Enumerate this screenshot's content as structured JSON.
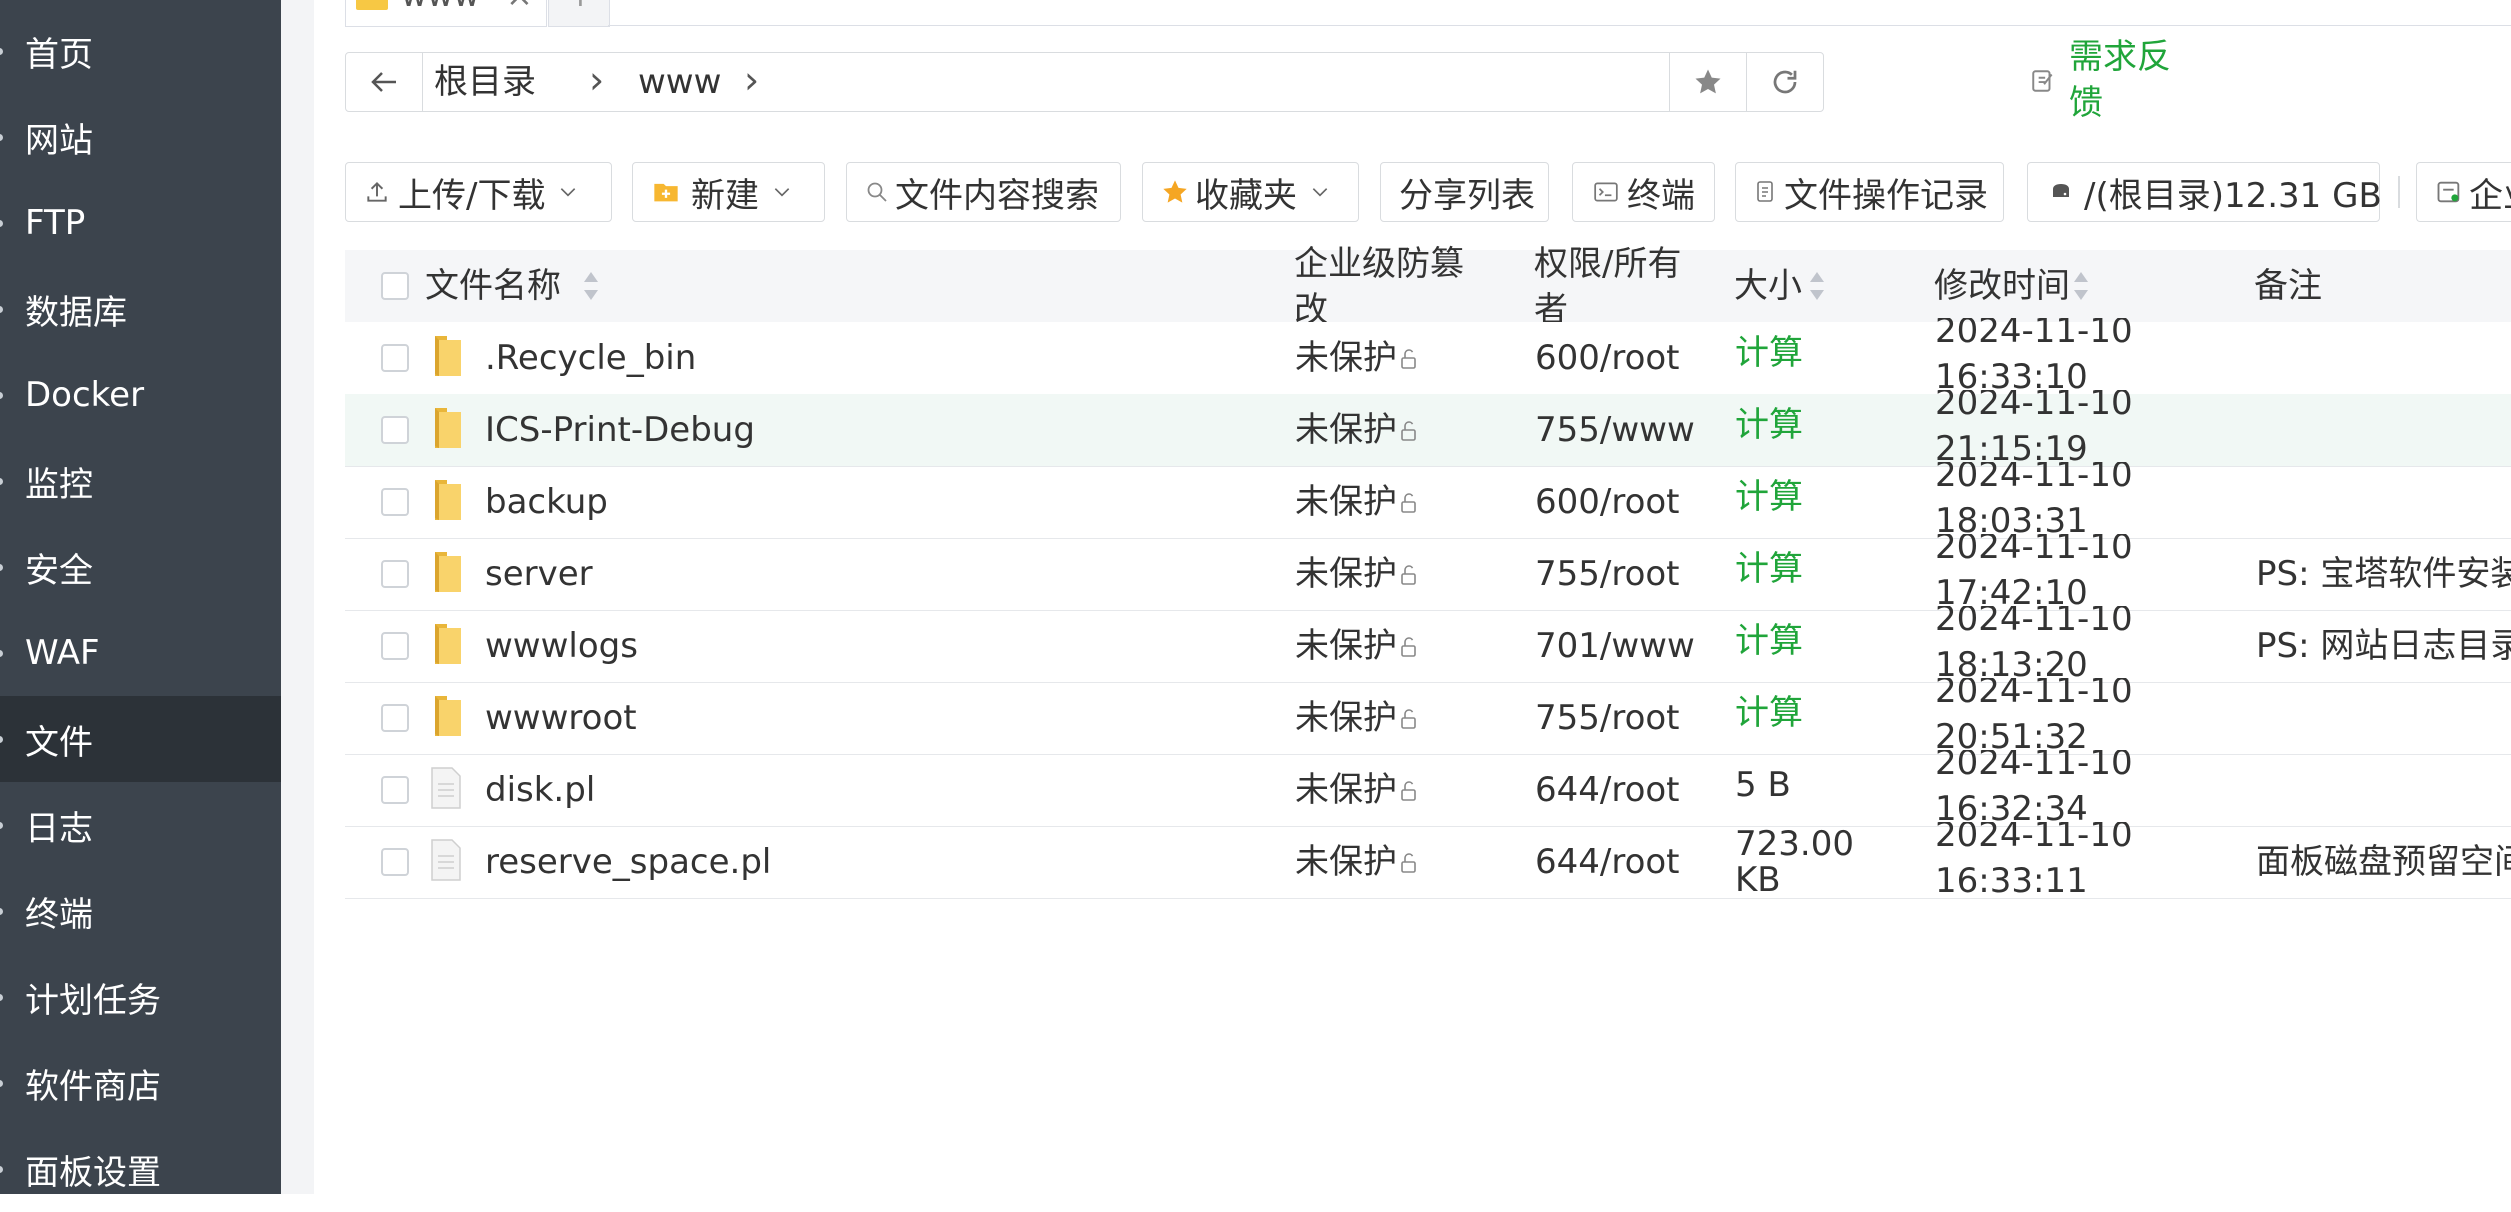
{
  "sidebar": {
    "items": [
      {
        "label": "首页"
      },
      {
        "label": "网站"
      },
      {
        "label": "FTP"
      },
      {
        "label": "数据库"
      },
      {
        "label": "Docker"
      },
      {
        "label": "监控"
      },
      {
        "label": "安全"
      },
      {
        "label": "WAF"
      },
      {
        "label": "文件",
        "active": true
      },
      {
        "label": "日志"
      },
      {
        "label": "终端"
      },
      {
        "label": "计划任务"
      },
      {
        "label": "软件商店"
      },
      {
        "label": "面板设置"
      }
    ]
  },
  "tabs": {
    "current": "www",
    "close": "×",
    "add": "+"
  },
  "breadcrumb": {
    "root": "根目录",
    "current": "www",
    "sep": "›"
  },
  "feedback": {
    "line1": "需求反",
    "line2": "馈"
  },
  "toolbar": {
    "upload": "上传/下载",
    "new": "新建",
    "search": "文件内容搜索",
    "favorites": "收藏夹",
    "share": "分享列表",
    "terminal": "终端",
    "oplog": "文件操作记录",
    "disk": "/(根目录)12.31 GB",
    "enterprise": "企业"
  },
  "table": {
    "headers": {
      "name": "文件名称",
      "protect_1": "企业级防篡",
      "protect_2": "改",
      "perm_1": "权限/所有",
      "perm_2": "者",
      "size": "大小",
      "mtime": "修改时间",
      "note": "备注"
    },
    "rows": [
      {
        "name": ".Recycle_bin",
        "type": "folder",
        "protect": "未保护",
        "perm": "600/root",
        "size1": "计算",
        "size2": "",
        "size_green": true,
        "date": "2024-11-10",
        "time": "16:33:10",
        "note": ""
      },
      {
        "name": "ICS-Print-Debug",
        "type": "folder",
        "protect": "未保护",
        "perm": "755/www",
        "size1": "计算",
        "size2": "",
        "size_green": true,
        "date": "2024-11-10",
        "time": "21:15:19",
        "note": ""
      },
      {
        "name": "backup",
        "type": "folder",
        "protect": "未保护",
        "perm": "600/root",
        "size1": "计算",
        "size2": "",
        "size_green": true,
        "date": "2024-11-10",
        "time": "18:03:31",
        "note": ""
      },
      {
        "name": "server",
        "type": "folder",
        "protect": "未保护",
        "perm": "755/root",
        "size1": "计算",
        "size2": "",
        "size_green": true,
        "date": "2024-11-10",
        "time": "17:42:10",
        "note": "PS: 宝塔软件安装目"
      },
      {
        "name": "wwwlogs",
        "type": "folder",
        "protect": "未保护",
        "perm": "701/www",
        "size1": "计算",
        "size2": "",
        "size_green": true,
        "date": "2024-11-10",
        "time": "18:13:20",
        "note": "PS: 网站日志目录"
      },
      {
        "name": "wwwroot",
        "type": "folder",
        "protect": "未保护",
        "perm": "755/root",
        "size1": "计算",
        "size2": "",
        "size_green": true,
        "date": "2024-11-10",
        "time": "20:51:32",
        "note": ""
      },
      {
        "name": "disk.pl",
        "type": "file",
        "protect": "未保护",
        "perm": "644/root",
        "size1": "5 B",
        "size2": "",
        "size_green": false,
        "date": "2024-11-10",
        "time": "16:32:34",
        "note": ""
      },
      {
        "name": "reserve_space.pl",
        "type": "file",
        "protect": "未保护",
        "perm": "644/root",
        "size1": "723.00",
        "size2": "KB",
        "size_green": false,
        "date": "2024-11-10",
        "time": "16:33:11",
        "note": "面板磁盘预留空间文"
      }
    ]
  },
  "colors": {
    "accent": "#20a53a",
    "sidebar": "#3c444d",
    "sidebar_active": "#2c3238",
    "folder": "#f7c844"
  }
}
